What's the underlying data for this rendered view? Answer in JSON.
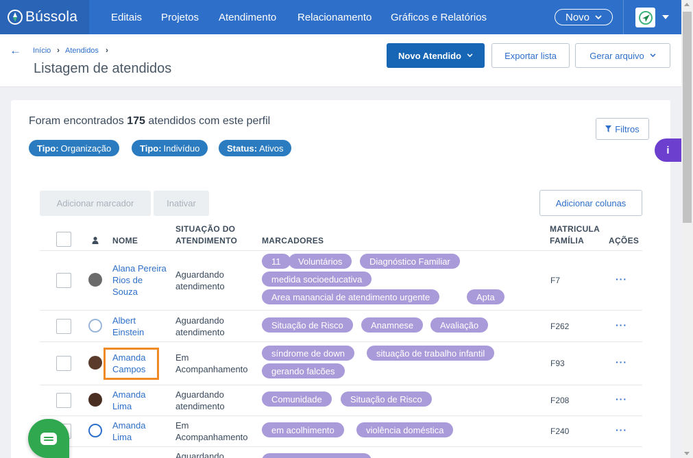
{
  "app": {
    "logo_text": "Bússola",
    "nav": [
      "Editais",
      "Projetos",
      "Atendimento",
      "Relacionamento",
      "Gráficos e Relatórios"
    ],
    "novo_label": "Novo",
    "brand_color": "#2e6fc9"
  },
  "breadcrumb": [
    "Início",
    "Atendidos"
  ],
  "page_title": "Listagem de atendidos",
  "header_buttons": {
    "novo_atendido": "Novo Atendido",
    "exportar": "Exportar lista",
    "gerar": "Gerar arquivo"
  },
  "summary": {
    "prefix": "Foram encontrados",
    "count": "175",
    "suffix": "atendidos com este perfil"
  },
  "filters": [
    {
      "key": "Tipo:",
      "value": "Organização"
    },
    {
      "key": "Tipo:",
      "value": "Indivíduo"
    },
    {
      "key": "Status:",
      "value": "Ativos"
    }
  ],
  "filtros_label": "Filtros",
  "info_label": "i",
  "actions": {
    "adicionar_marcador": "Adicionar marcador",
    "inativar": "Inativar",
    "adicionar_colunas": "Adicionar colunas"
  },
  "table": {
    "headers": {
      "nome": "NOME",
      "situacao_1": "SITUAÇÃO DO",
      "situacao_2": "ATENDIMENTO",
      "marcadores": "MARCADORES",
      "matricula_1": "MATRICULA",
      "matricula_2": "FAMÍLIA",
      "acoes": "AÇÕES"
    },
    "rows": [
      {
        "name": [
          "Alana Pereira",
          "Rios de",
          "Souza"
        ],
        "situation": [
          "Aguardando",
          "atendimento"
        ],
        "tags": [
          "11",
          "Voluntários",
          "Diagnóstico Familiar",
          "medida socioeducativa",
          "Area manancial de atendimento urgente",
          "Apta"
        ],
        "matricula": "F7",
        "acoes": "···"
      },
      {
        "name": [
          "Albert",
          "Einstein"
        ],
        "situation": [
          "Aguardando",
          "atendimento"
        ],
        "tags": [
          "Situação de Risco",
          "Anamnese",
          "Avaliação"
        ],
        "matricula": "F262",
        "acoes": "···"
      },
      {
        "name": [
          "Amanda",
          "Campos"
        ],
        "situation": [
          "Em",
          "Acompanhamento"
        ],
        "tags": [
          "síndrome de down",
          "situação de trabalho infantil",
          "gerando falcões"
        ],
        "matricula": "F93",
        "acoes": "···"
      },
      {
        "name": [
          "Amanda",
          "Lima"
        ],
        "situation": [
          "Aguardando",
          "atendimento"
        ],
        "tags": [
          "Comunidade",
          "Situação de Risco"
        ],
        "matricula": "F208",
        "acoes": "···"
      },
      {
        "name": [
          "Amanda",
          "Lima"
        ],
        "situation": [
          "Em",
          "Acompanhamento"
        ],
        "tags": [
          "em acolhimento",
          "violência doméstica"
        ],
        "matricula": "F240",
        "acoes": "···"
      },
      {
        "situation": [
          "Aguardando"
        ]
      }
    ]
  },
  "colors": {
    "tag": "#a99ad9",
    "chip": "#2a7bc0",
    "highlight": "#f08a24",
    "chat": "#2fa84f",
    "info": "#6c3fcf"
  }
}
